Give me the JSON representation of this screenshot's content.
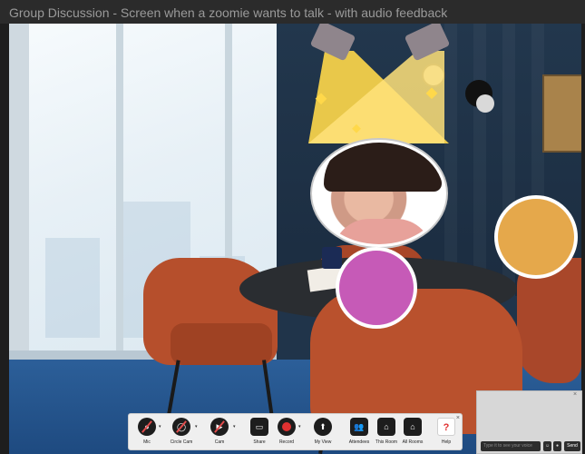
{
  "window": {
    "title": "Group Discussion - Screen when a zoomie wants to talk - with audio feedback"
  },
  "toolbar": {
    "buttons": [
      {
        "label": "Mic",
        "icon": "mic-muted-icon"
      },
      {
        "label": "Circle Cam",
        "icon": "circle-cam-icon"
      },
      {
        "label": "Cam",
        "icon": "camera-muted-icon"
      },
      {
        "label": "Share",
        "icon": "share-screen-icon"
      },
      {
        "label": "Record",
        "icon": "record-icon"
      },
      {
        "label": "My View",
        "icon": "my-view-icon"
      },
      {
        "label": "Attendees",
        "icon": "attendees-icon"
      },
      {
        "label": "This Room",
        "icon": "home-icon"
      },
      {
        "label": "All Rooms",
        "icon": "all-rooms-icon"
      },
      {
        "label": "Help",
        "icon": "help-icon"
      }
    ],
    "help_glyph": "?"
  },
  "chat": {
    "placeholder": "Type it to see your voice",
    "send_label": "Send"
  },
  "participants": {
    "pink_color": "#c65ab7",
    "orange_color": "#e5a84b"
  },
  "colors": {
    "spotlight": "#ffd84a",
    "record": "#e03131"
  }
}
